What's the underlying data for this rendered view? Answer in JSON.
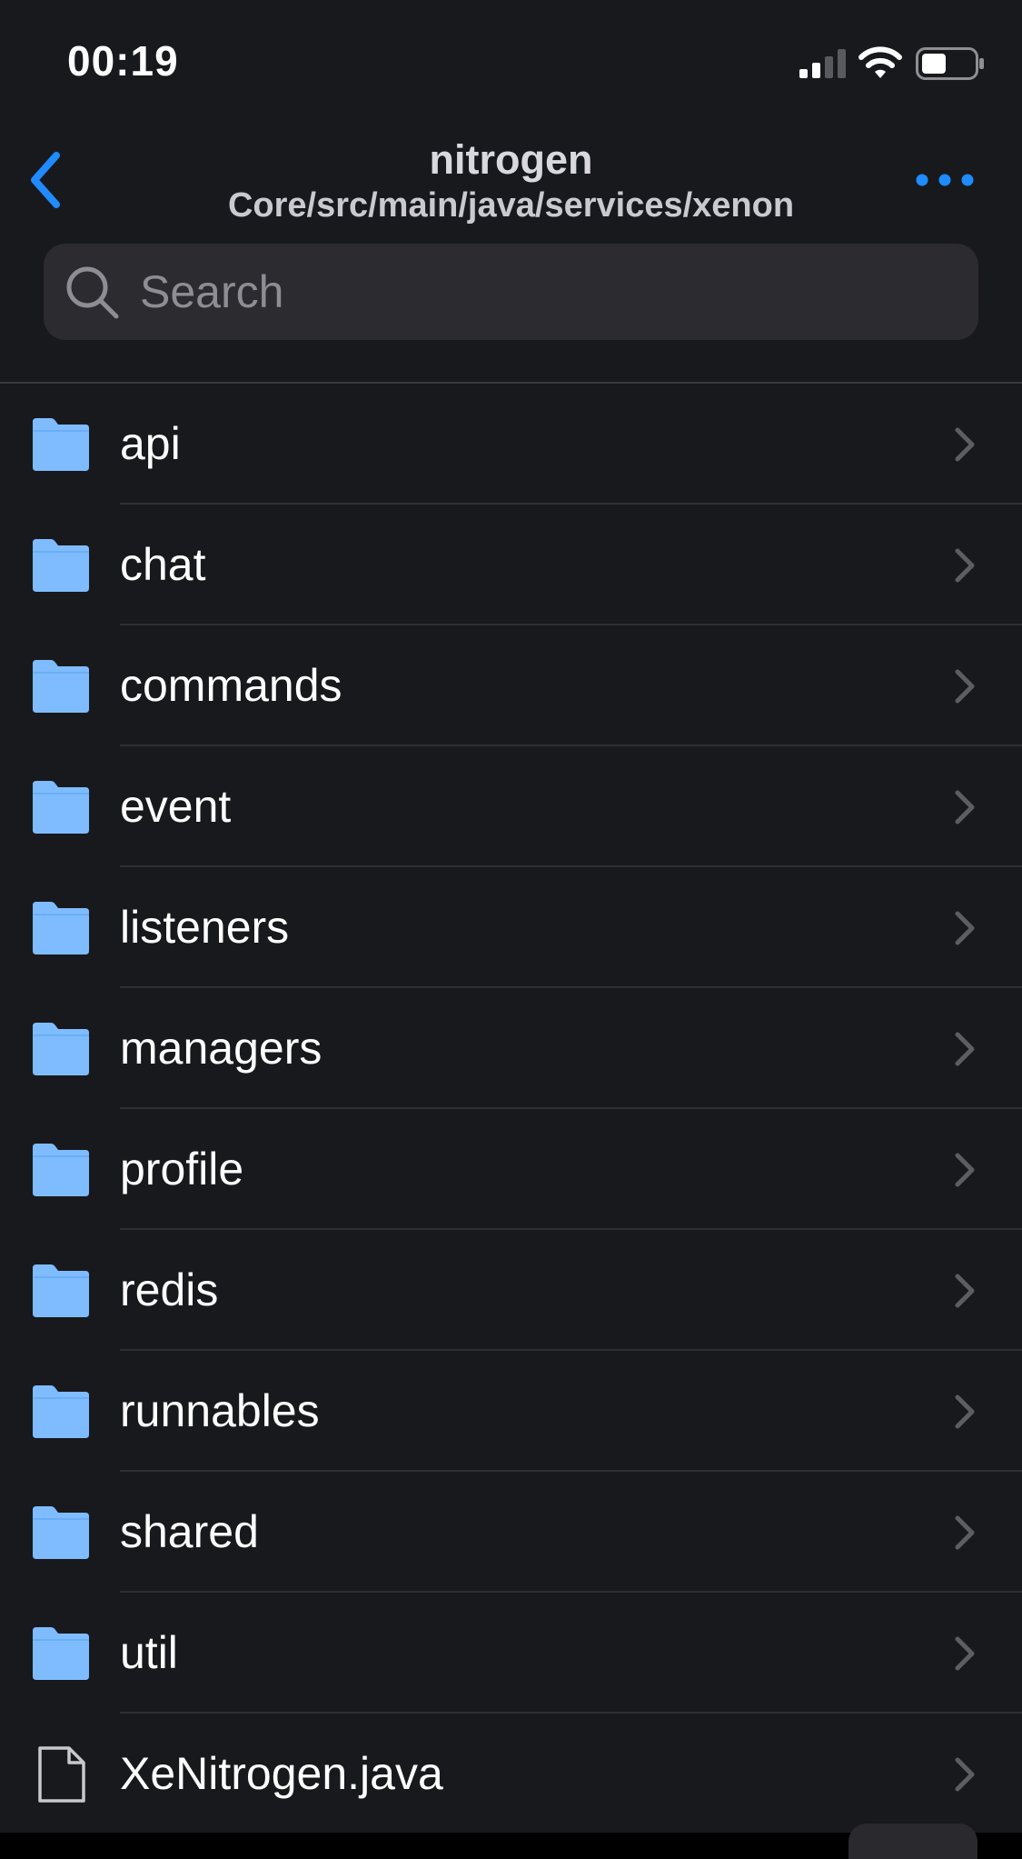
{
  "status_bar": {
    "time": "00:19",
    "icons": [
      "signal-icon",
      "wifi-icon",
      "battery-icon"
    ]
  },
  "nav": {
    "title": "nitrogen",
    "subtitle": "Core/src/main/java/services/xenon",
    "back_icon": "chevron-left-icon",
    "more_icon": "ellipsis-icon"
  },
  "search": {
    "placeholder": "Search",
    "value": ""
  },
  "items": [
    {
      "label": "api",
      "type": "folder"
    },
    {
      "label": "chat",
      "type": "folder"
    },
    {
      "label": "commands",
      "type": "folder"
    },
    {
      "label": "event",
      "type": "folder"
    },
    {
      "label": "listeners",
      "type": "folder"
    },
    {
      "label": "managers",
      "type": "folder"
    },
    {
      "label": "profile",
      "type": "folder"
    },
    {
      "label": "redis",
      "type": "folder"
    },
    {
      "label": "runnables",
      "type": "folder"
    },
    {
      "label": "shared",
      "type": "folder"
    },
    {
      "label": "util",
      "type": "folder"
    },
    {
      "label": "XeNitrogen.java",
      "type": "file"
    }
  ],
  "colors": {
    "background": "#18191d",
    "accent": "#1f8bff",
    "folder": "#7fbcff",
    "divider": "#2f2f33",
    "chevron": "#5d5d62",
    "search_bg": "#2c2c30"
  }
}
